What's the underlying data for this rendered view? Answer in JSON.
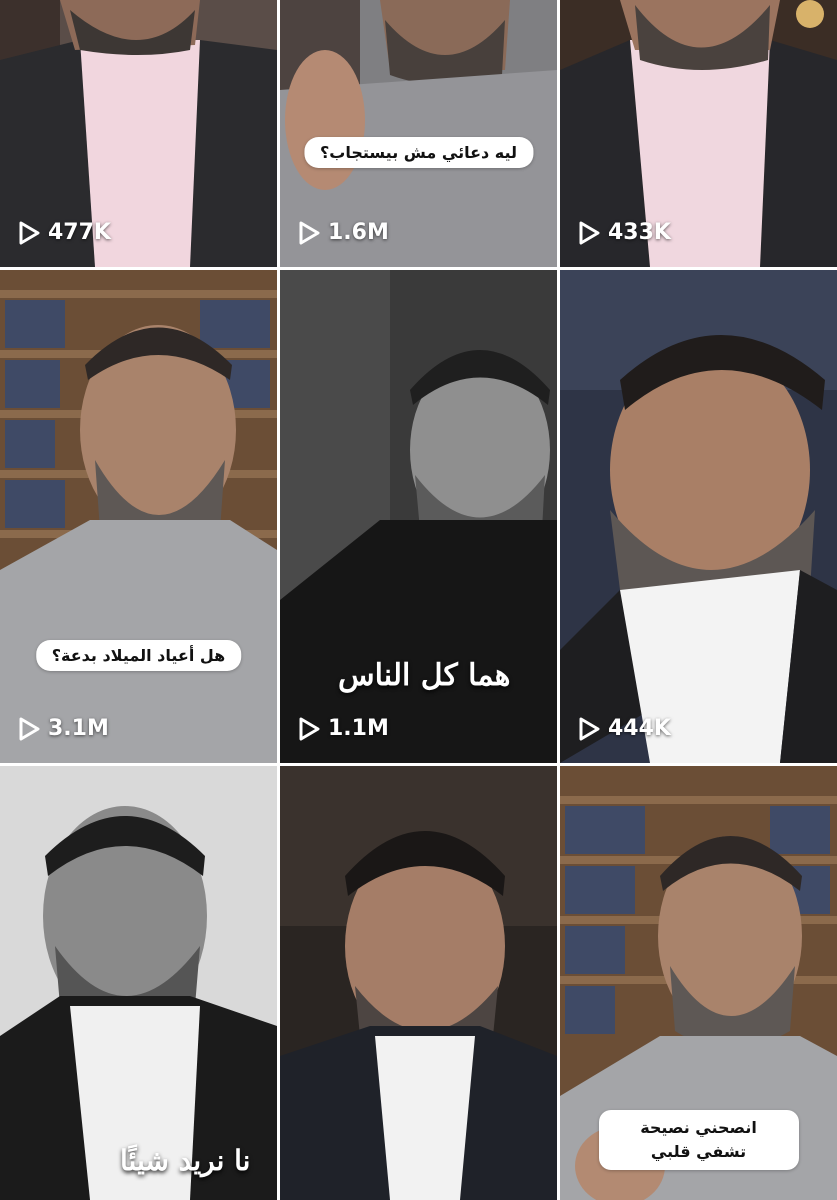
{
  "colors": {
    "overlay_text": "#ffffff",
    "pill_background": "#ffffff",
    "pill_text": "#111111"
  },
  "tiles": [
    {
      "views": "477K",
      "caption": ""
    },
    {
      "views": "1.6M",
      "caption": "ليه دعائي مش بيستجاب؟"
    },
    {
      "views": "433K",
      "caption": ""
    },
    {
      "views": "3.1M",
      "caption": "هل أعياد الميلاد بدعة؟"
    },
    {
      "views": "1.1M",
      "overlay_text": "هما كل الناس"
    },
    {
      "views": "444K",
      "caption": ""
    },
    {
      "views": "",
      "overlay_text": "نا نريد شيئًا"
    },
    {
      "views": "",
      "caption": ""
    },
    {
      "views": "",
      "caption": "انصحني نصيحة تشفي قلبي"
    }
  ],
  "icons": {
    "play": "play-icon"
  }
}
